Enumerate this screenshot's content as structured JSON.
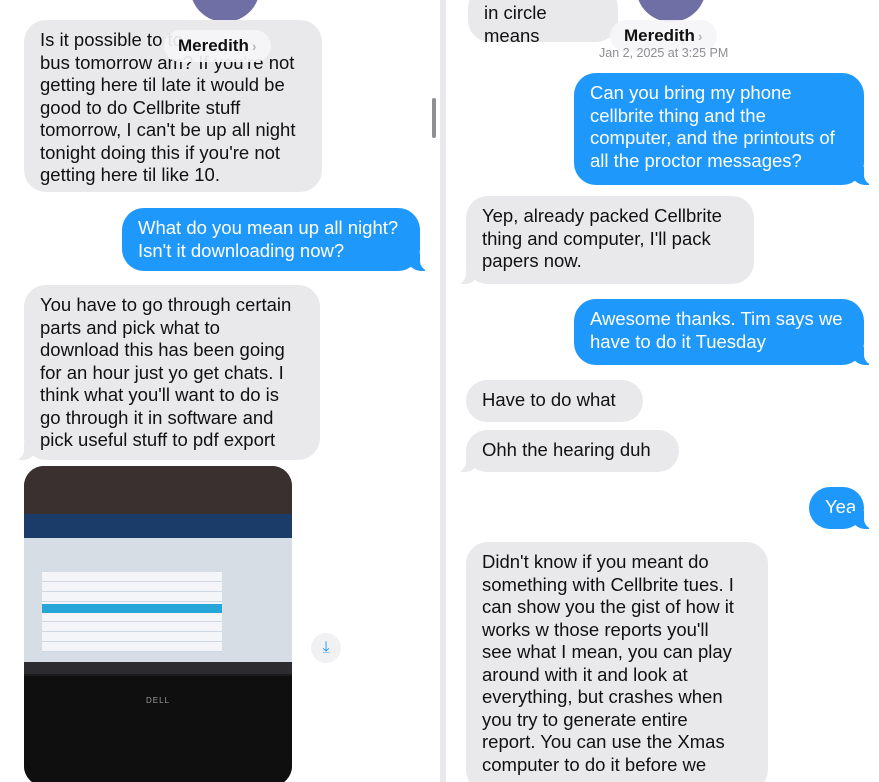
{
  "left": {
    "contact": {
      "name": "Meredith",
      "chevron": "›"
    },
    "messages": [
      {
        "id": "l1",
        "dir": "in",
        "text": "Is it possible to          to\nbus tomorrow am? If you're not\ngetting here til late it would be\ngood to do Cellbrite stuff\ntomorrow, I can't be up all night\ntonight doing this if you're not\ngetting here til like 10."
      },
      {
        "id": "l2",
        "dir": "out",
        "text": "What do you mean up all night?\nIsn't it downloading now?"
      },
      {
        "id": "l3",
        "dir": "in",
        "text": "You have to go through certain\nparts and pick what to\ndownload this has been going\nfor an hour just yo get chats. I\nthink what you'll want to do is\ngo through it in software and\npick useful stuff to pdf export"
      }
    ],
    "photo": {
      "brand": "DELL"
    },
    "download_icon": "download-icon"
  },
  "right": {
    "contact": {
      "name": "Meredith",
      "chevron": "›"
    },
    "top_fragment": "in circle means",
    "timestamp": "Jan 2, 2025 at 3:25 PM",
    "messages": [
      {
        "id": "r1",
        "dir": "out",
        "text": "Can you bring my phone\ncellbrite thing and the\ncomputer, and the printouts of\nall the proctor messages?"
      },
      {
        "id": "r2",
        "dir": "in",
        "text": "Yep, already packed Cellbrite\nthing and computer, I'll pack\npapers now."
      },
      {
        "id": "r3",
        "dir": "out",
        "text": "Awesome thanks. Tim says we\nhave to do it Tuesday"
      },
      {
        "id": "r4",
        "dir": "in",
        "text": "Have to do what"
      },
      {
        "id": "r5",
        "dir": "in",
        "text": "Ohh the hearing duh"
      },
      {
        "id": "r6",
        "dir": "out",
        "text": "Yea"
      },
      {
        "id": "r7",
        "dir": "in",
        "text": "Didn't know if you meant do\nsomething with Cellbrite tues. I\ncan show you the gist of how it\nworks w those reports you'll\nsee what I mean, you can play\naround with it and look at\neverything, but crashes when\nyou try to generate entire\nreport. You can use the Xmas\ncomputer to do it before we"
      }
    ]
  },
  "colors": {
    "incoming": "#e9e9eb",
    "outgoing": "#1e98fb",
    "timestamp": "#8e8e93"
  }
}
